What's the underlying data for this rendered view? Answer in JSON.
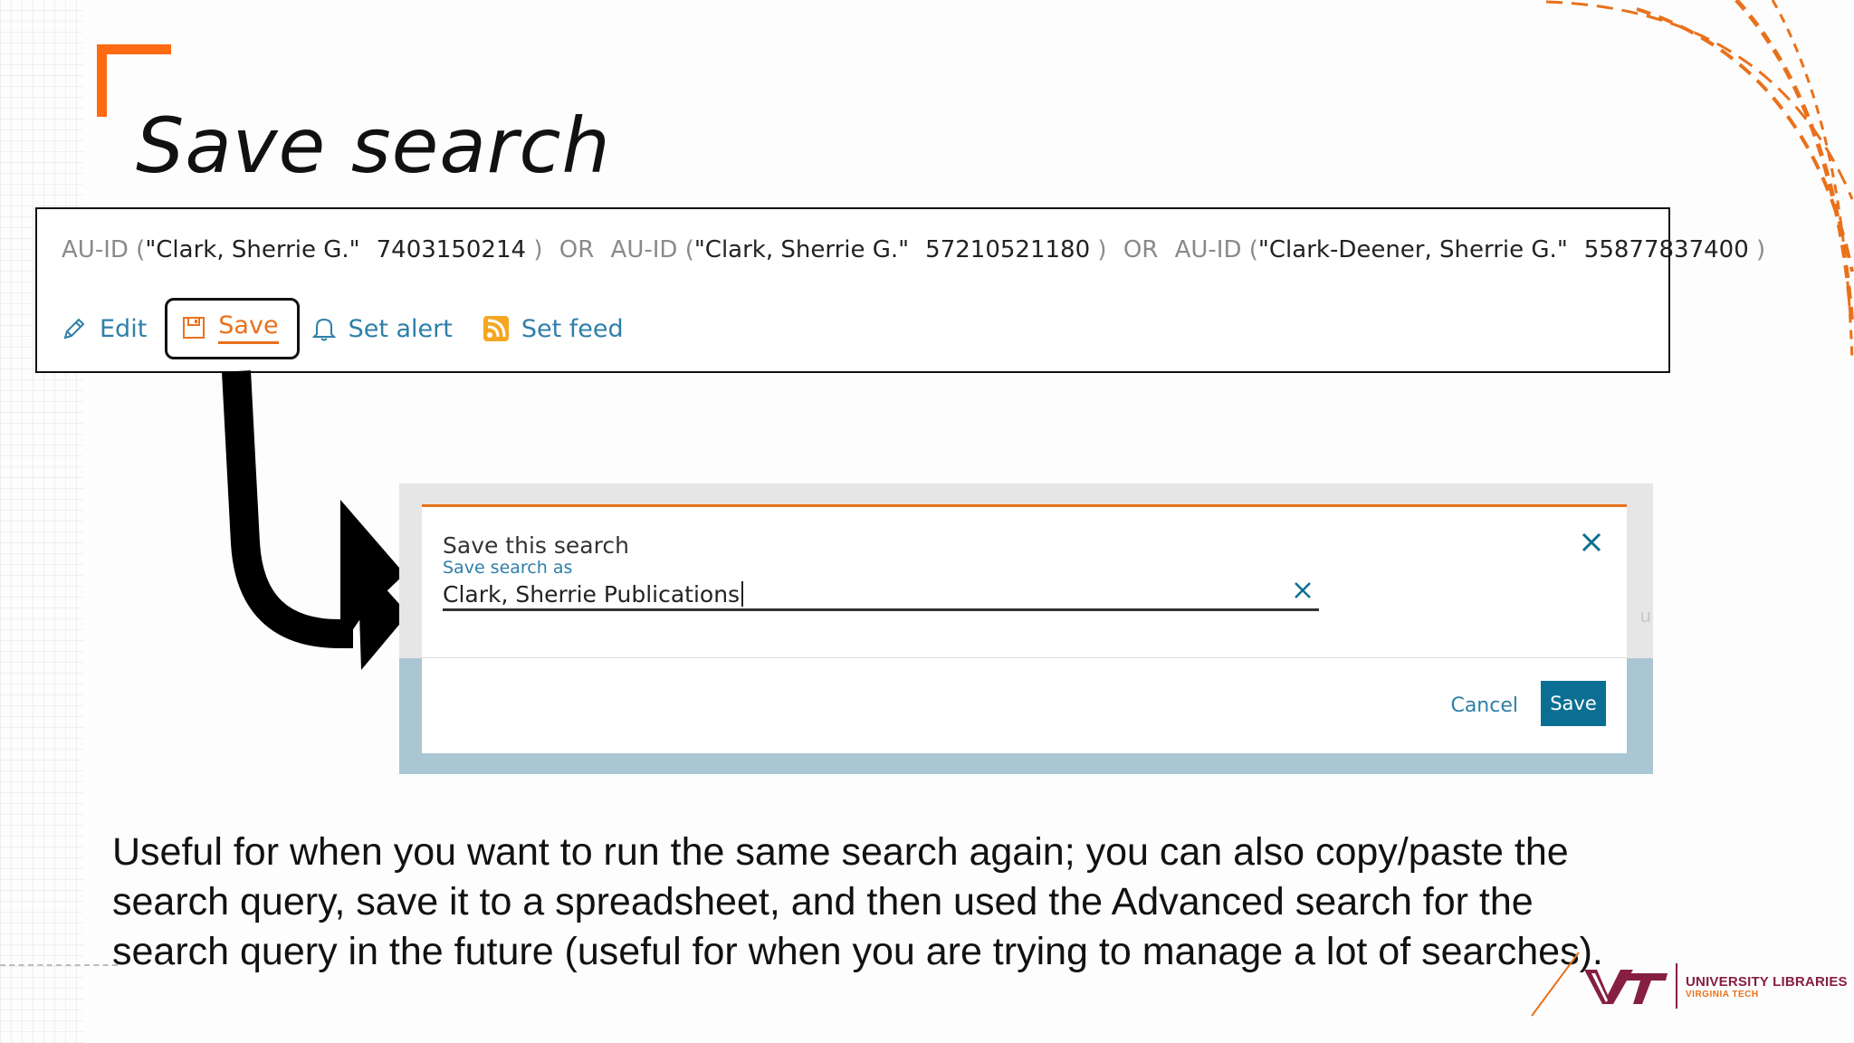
{
  "slide": {
    "title": "Save search",
    "body": "Useful for when you want to run the same search again; you can also copy/paste the search query, save it to a spreadsheet, and then used the Advanced search for the search query in the future (useful for when you are trying to manage a lot of searches)."
  },
  "query": {
    "terms": [
      {
        "key": "AU-ID",
        "open": "(",
        "name": "\"Clark, Sherrie G.\"",
        "id": "7403150214",
        "close": ")"
      },
      {
        "key": "AU-ID",
        "open": "(",
        "name": "\"Clark, Sherrie G.\"",
        "id": "57210521180",
        "close": ")"
      },
      {
        "key": "AU-ID",
        "open": "(",
        "name": "\"Clark-Deener, Sherrie G.\"",
        "id": "55877837400",
        "close": ")"
      }
    ],
    "operator": "OR"
  },
  "actions": {
    "edit_label": "Edit",
    "save_label": "Save",
    "set_alert_label": "Set alert",
    "set_feed_label": "Set feed"
  },
  "dialog": {
    "title": "Save this search",
    "field_label": "Save search as",
    "field_value": "Clark, Sherrie Publications",
    "cancel_label": "Cancel",
    "save_label": "Save",
    "ghost_text": "u"
  },
  "logo": {
    "name": "UNIVERSITY LIBRARIES",
    "sub": "VIRGINIA TECH"
  },
  "colors": {
    "accent_orange": "#ff6a13",
    "link_blue": "#2e7fa8",
    "save_button": "#0a6f93",
    "vt_maroon": "#861f41"
  },
  "icons": [
    "pencil-icon",
    "save-disk-icon",
    "bell-icon",
    "rss-icon",
    "close-icon",
    "clear-icon",
    "arrow-icon"
  ]
}
